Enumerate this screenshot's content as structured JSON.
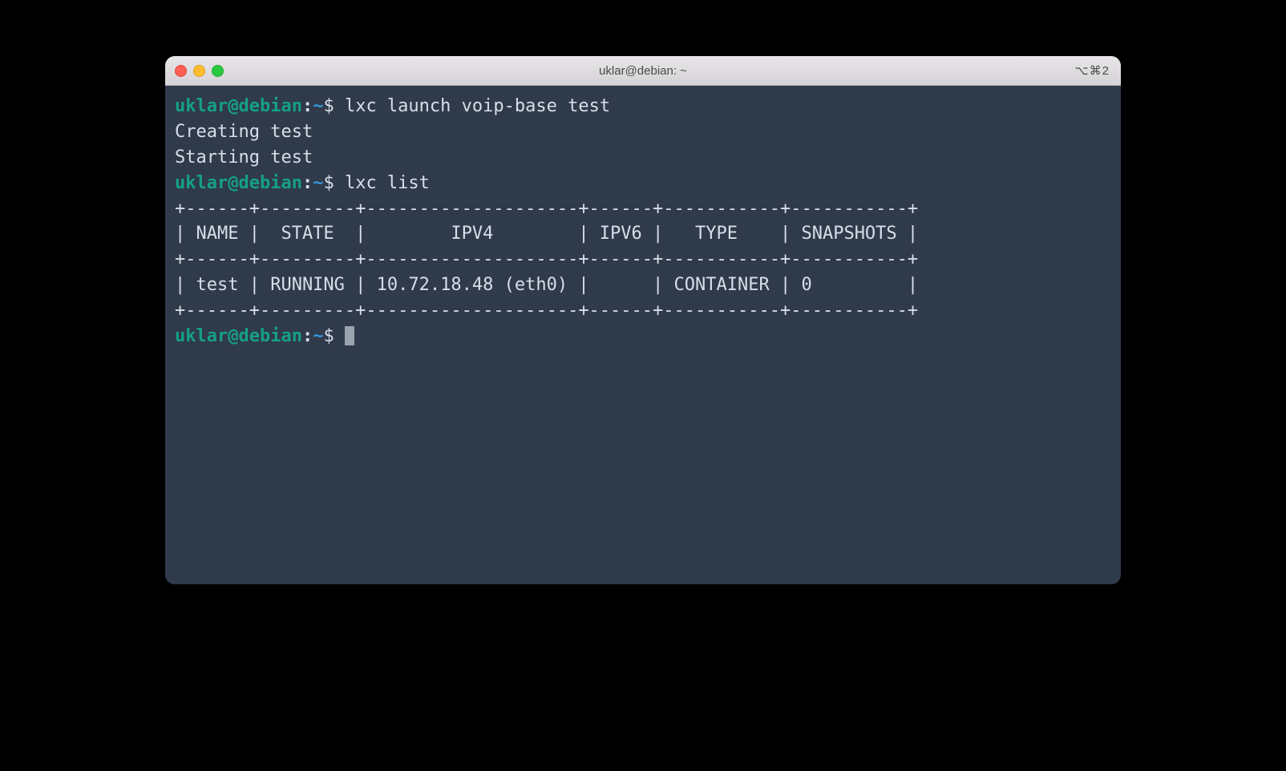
{
  "window": {
    "title": "uklar@debian: ~",
    "shortcut": "⌥⌘2"
  },
  "prompt": {
    "user_host": "uklar@debian",
    "colon": ":",
    "path": "~",
    "dollar": "$"
  },
  "lines": {
    "cmd1": " lxc launch voip-base test",
    "out1": "Creating test",
    "out2": "Starting test",
    "cmd2": " lxc list",
    "sep": "+------+---------+--------------------+------+-----------+-----------+",
    "hdr": "| NAME |  STATE  |        IPV4        | IPV6 |   TYPE    | SNAPSHOTS |",
    "row": "| test | RUNNING | 10.72.18.48 (eth0) |      | CONTAINER | 0         |",
    "cmd3": " "
  },
  "table": {
    "headers": [
      "NAME",
      "STATE",
      "IPV4",
      "IPV6",
      "TYPE",
      "SNAPSHOTS"
    ],
    "rows": [
      {
        "name": "test",
        "state": "RUNNING",
        "ipv4": "10.72.18.48 (eth0)",
        "ipv6": "",
        "type": "CONTAINER",
        "snapshots": "0"
      }
    ]
  }
}
